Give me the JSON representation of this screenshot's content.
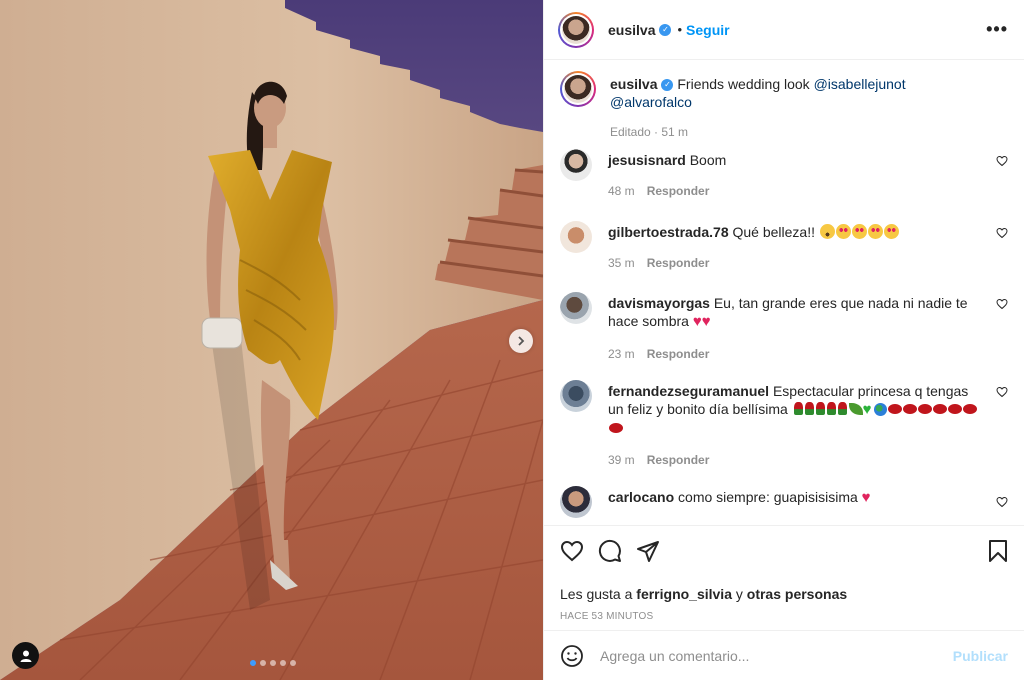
{
  "header": {
    "username": "eusilva",
    "separator": "•",
    "follow_label": "Seguir",
    "more_label": "•••"
  },
  "caption": {
    "username": "eusilva",
    "text": "Friends wedding look",
    "mention_1": "@isabellejunot",
    "mention_2": "@alvarofalco",
    "meta": "Editado · 51 m"
  },
  "comments": [
    {
      "username": "jesusisnard",
      "text": "Boom",
      "time": "48 m",
      "reply_label": "Responder"
    },
    {
      "username": "gilbertoestrada.78",
      "text": "Qué belleza!!",
      "time": "35 m",
      "reply_label": "Responder",
      "emojis": [
        "astonished-face",
        "heart-eyes",
        "heart-eyes",
        "heart-eyes",
        "heart-eyes"
      ]
    },
    {
      "username": "davismayorgas",
      "text": "Eu, tan grande eres que nada ni nadie te hace sombra",
      "time": "23 m",
      "reply_label": "Responder",
      "emojis": [
        "red-heart",
        "red-heart"
      ]
    },
    {
      "username": "fernandezseguramanuel",
      "text": "Espectacular princesa q tengas un feliz y bonito día bellísima",
      "time": "39 m",
      "reply_label": "Responder",
      "emojis": [
        "rose",
        "rose",
        "rose",
        "rose",
        "rose",
        "herb",
        "green-heart",
        "globe",
        "lips",
        "lips",
        "lips",
        "lips",
        "lips",
        "lips",
        "lips"
      ]
    },
    {
      "username": "carlocano",
      "text": "como siempre: guapisisisima",
      "emojis": [
        "red-heart"
      ]
    }
  ],
  "actions": {
    "likes_prefix": "Les gusta a",
    "likes_user": "ferrigno_silvia",
    "likes_connector": "y",
    "likes_others": "otras personas",
    "ago": "HACE 53 MINUTOS"
  },
  "composer": {
    "placeholder": "Agrega un comentario...",
    "publish_label": "Publicar"
  },
  "carousel": {
    "count": 5,
    "active_index": 0
  },
  "colors": {
    "link_blue": "#0095f6",
    "mention_blue": "#00376b",
    "muted": "#8e8e8e",
    "publish_disabled": "#b2dffc",
    "dress_gold": "#c9961c"
  }
}
